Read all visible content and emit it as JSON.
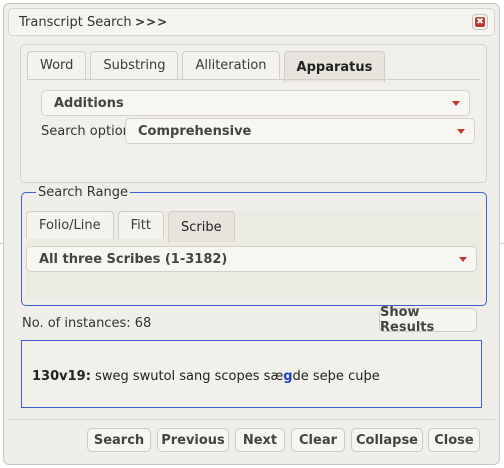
{
  "titlebar": {
    "title": "Transcript Search",
    "expand_label": ">>>",
    "close_symbol": "✖"
  },
  "search_panel": {
    "tabs": [
      {
        "label": "Word",
        "active": false
      },
      {
        "label": "Substring",
        "active": false
      },
      {
        "label": "Alliteration",
        "active": false
      },
      {
        "label": "Apparatus",
        "active": true
      }
    ],
    "type_select": {
      "value": "Additions"
    },
    "options_label": "Search options:",
    "options_select": {
      "value": "Comprehensive"
    }
  },
  "search_range": {
    "legend": "Search Range",
    "tabs": [
      {
        "label": "Folio/Line",
        "active": false
      },
      {
        "label": "Fitt",
        "active": false
      },
      {
        "label": "Scribe",
        "active": true
      }
    ],
    "scribe_select": {
      "value": "All three Scribes (1-3182)"
    }
  },
  "results": {
    "instances_label": "No. of instances: 68",
    "show_results_label": "Show Results",
    "lines": [
      {
        "ref": "130v19:",
        "before": "sweg swutol sang scopes sæ",
        "highlight": "g",
        "after": "de seþe cuþe"
      }
    ]
  },
  "footer_buttons": {
    "search": "Search",
    "previous": "Previous",
    "next": "Next",
    "clear": "Clear",
    "collapse": "Collapse",
    "close": "Close"
  },
  "colors": {
    "accent_border": "#3f5fd0",
    "caret": "#c0392b",
    "highlight": "#1a3fd0"
  }
}
